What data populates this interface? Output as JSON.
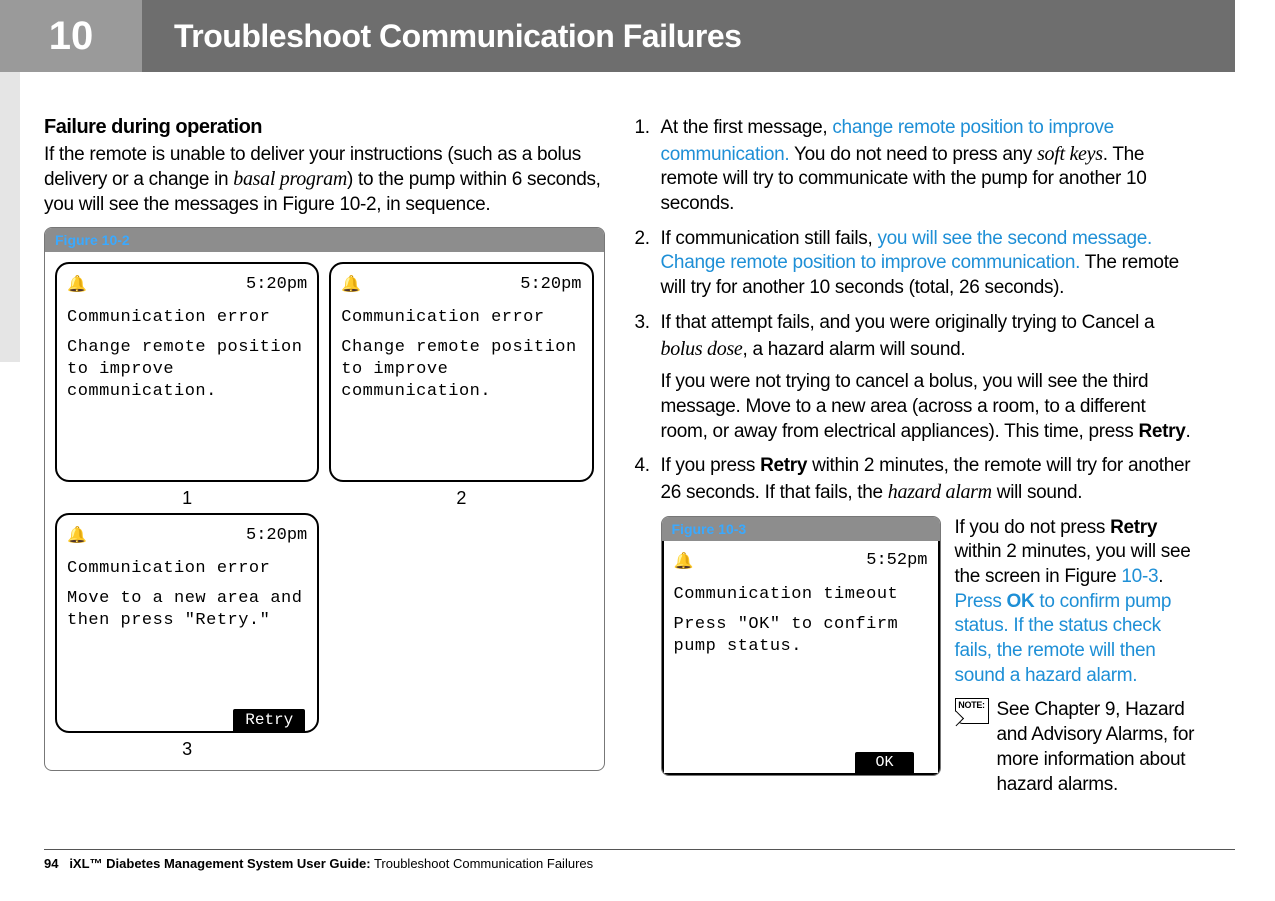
{
  "header": {
    "chapter_number": "10",
    "title": "Troubleshoot Communication Failures"
  },
  "left": {
    "heading": "Failure during operation",
    "intro_pre": "If the remote is unable to deliver your instructions (such as a bolus delivery or a change in ",
    "intro_ital": "basal program",
    "intro_post": ") to the pump within 6 seconds, you will see the messages in Figure 10-2, in sequence.",
    "figure_label": "Figure 10-2",
    "screens": {
      "time": "5:20pm",
      "s1_title": "Communication error",
      "s1_body": "Change remote position to improve communication.",
      "s2_title": "Communication error",
      "s2_body": "Change remote position to improve communication.",
      "s3_title": "Communication error",
      "s3_body": "Move to a new area and then press \"Retry.\"",
      "retry_label": "Retry",
      "n1": "1",
      "n2": "2",
      "n3": "3"
    }
  },
  "right": {
    "step1_a": "At the first message, ",
    "step1_blue": "change remote position to improve communication.",
    "step1_b": " You do not need to press any ",
    "step1_ital": "soft keys",
    "step1_c": ". The remote will try to communicate with the pump for another 10 seconds.",
    "step2_a": "If communication still fails, ",
    "step2_blue": "you will see the second message. Change remote position to improve communication.",
    "step2_b": " The remote will try for another 10 seconds (total, 26 seconds).",
    "step3_a": "If that attempt fails, and you were originally trying to Cancel a ",
    "step3_ital": "bolus dose",
    "step3_b": ", a hazard alarm will sound.",
    "step3_para2_a": "If you were not trying to cancel a bolus, you will see the third message. Move to a new area (across a room, to a different room, or away from electrical appliances). This time, press ",
    "step3_para2_bold": "Retry",
    "step3_para2_b": ".",
    "step4_a": "If you press ",
    "step4_bold": "Retry",
    "step4_b": " within 2 minutes, the remote will try for another 26 seconds. If that fails, the ",
    "step4_ital": "hazard alarm",
    "step4_c": " will sound.",
    "figure103_label": "Figure 10-3",
    "fig103_time": "5:52pm",
    "fig103_title": "Communication timeout",
    "fig103_body": "Press \"OK\" to confirm pump status.",
    "fig103_ok": "OK",
    "side_a": "If you do not press ",
    "side_bold": "Retry",
    "side_b": " within 2 minutes, you will see the screen in Figure ",
    "side_blue1": "10-3",
    "side_c": ". ",
    "side_blue2_a": "Press ",
    "side_blue2_bold": "OK",
    "side_blue2_b": " to confirm pump status. If the status check fails, the remote will then sound a hazard alarm.",
    "note_label": "NOTE:",
    "note_text": "See Chapter 9, Hazard and Advisory Alarms, for more information about hazard alarms."
  },
  "footer": {
    "page_num": "94",
    "guide": "iXL™ Diabetes Management System User Guide:",
    "section": " Troubleshoot Communication Failures"
  }
}
